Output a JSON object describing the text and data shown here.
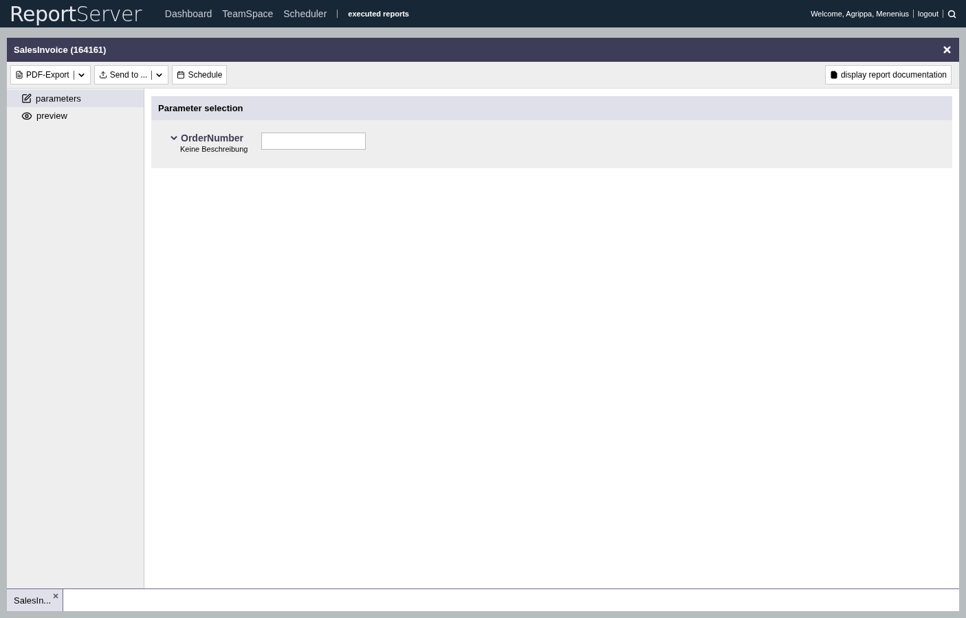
{
  "topbar": {
    "logo": "**Report**Server",
    "nav": [
      {
        "label": "Dashboard",
        "selected": false
      },
      {
        "label": "TeamSpace",
        "selected": false
      },
      {
        "label": "Scheduler",
        "selected": false
      },
      {
        "label": "executed reports",
        "selected": true
      }
    ],
    "welcome": "Welcome, Agrippa, Menenius",
    "logout": "logout"
  },
  "window": {
    "title": "SalesInvoice (164161)"
  },
  "toolbar": {
    "buttons": [
      {
        "kind": "pdf",
        "label": "PDF-Export",
        "dropdown": true
      },
      {
        "kind": "send",
        "label": "Send to ...",
        "dropdown": true
      },
      {
        "kind": "calendar",
        "label": "Schedule",
        "dropdown": false
      }
    ],
    "doc_button": "display report documentation"
  },
  "sidebar": {
    "items": [
      {
        "kind": "edit",
        "label": "parameters",
        "selected": true
      },
      {
        "kind": "view",
        "label": "preview",
        "selected": false
      }
    ]
  },
  "parameter_panel": {
    "title": "Parameter selection",
    "params": [
      {
        "name": "OrderNumber",
        "description": "Keine Beschreibung",
        "expanded": true
      }
    ]
  },
  "bottom_tabs": [
    {
      "label": "SalesIn...",
      "selected": true
    }
  ]
}
